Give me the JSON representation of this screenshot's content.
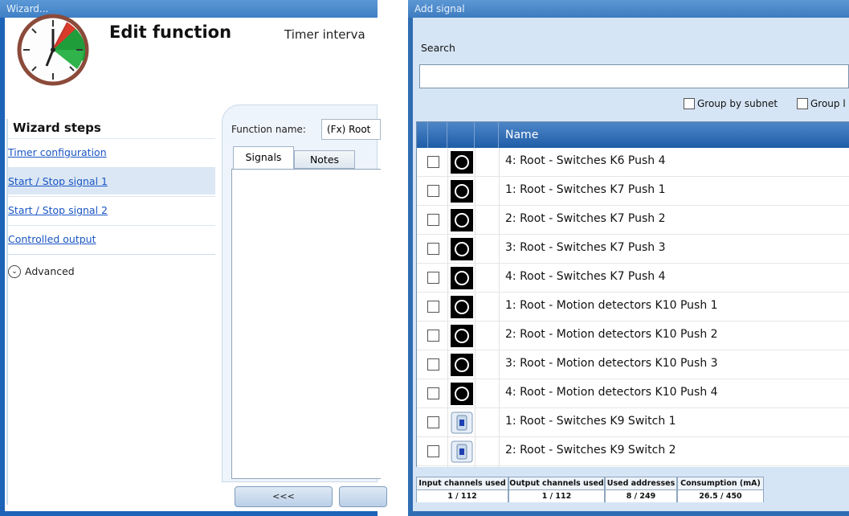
{
  "wizard": {
    "window_title": "Wizard...",
    "title": "Edit function",
    "function_type": "Timer interva",
    "steps_heading": "Wizard steps",
    "steps": [
      {
        "label": "Timer configuration"
      },
      {
        "label": "Start / Stop signal 1"
      },
      {
        "label": "Start / Stop signal 2"
      },
      {
        "label": "Controlled output"
      }
    ],
    "selected_step": 1,
    "advanced_label": "Advanced",
    "function_name_label": "Function name:",
    "function_name_value": "(Fx) Root",
    "tabs": [
      "Signals",
      "Notes"
    ],
    "prev_button": "<<<",
    "clock_icon": "timer-clock-icon",
    "colors": {
      "accent_green": "#1f9d3a",
      "clock_rim": "#8b4a3a",
      "window_blue": "#1d63b8"
    }
  },
  "add_signal": {
    "window_title": "Add signal",
    "search_label": "Search",
    "search_value": "",
    "group_by_subnet": "Group by subnet",
    "group_other": "Group l",
    "column_name": "Name",
    "rows": [
      {
        "name": "4: Root - Switches K6 Push 4",
        "icon": "push-button-icon",
        "checked": false
      },
      {
        "name": "1: Root - Switches K7 Push 1",
        "icon": "push-button-icon",
        "checked": false
      },
      {
        "name": "2: Root - Switches K7 Push 2",
        "icon": "push-button-icon",
        "checked": false
      },
      {
        "name": "3: Root - Switches K7 Push 3",
        "icon": "push-button-icon",
        "checked": false
      },
      {
        "name": "4: Root - Switches K7 Push 4",
        "icon": "push-button-icon",
        "checked": false
      },
      {
        "name": "1: Root - Motion detectors K10 Push 1",
        "icon": "push-button-icon",
        "checked": false
      },
      {
        "name": "2: Root - Motion detectors K10 Push 2",
        "icon": "push-button-icon",
        "checked": false
      },
      {
        "name": "3: Root - Motion detectors K10 Push 3",
        "icon": "push-button-icon",
        "checked": false
      },
      {
        "name": "4: Root - Motion detectors K10 Push 4",
        "icon": "push-button-icon",
        "checked": false
      },
      {
        "name": "1: Root - Switches K9 Switch 1",
        "icon": "switch-icon",
        "checked": false
      },
      {
        "name": "2: Root - Switches K9 Switch 2",
        "icon": "switch-icon",
        "checked": false
      }
    ],
    "footer": [
      {
        "header": "Input channels used",
        "value": "1 / 112"
      },
      {
        "header": "Output channels used",
        "value": "1 / 112"
      },
      {
        "header": "Used addresses",
        "value": "8 / 249"
      },
      {
        "header": "Consumption (mA)",
        "value": "26.5 / 450"
      }
    ],
    "colors": {
      "header_blue": "#1f5da8",
      "panel_bg": "#d6e5f5"
    }
  }
}
